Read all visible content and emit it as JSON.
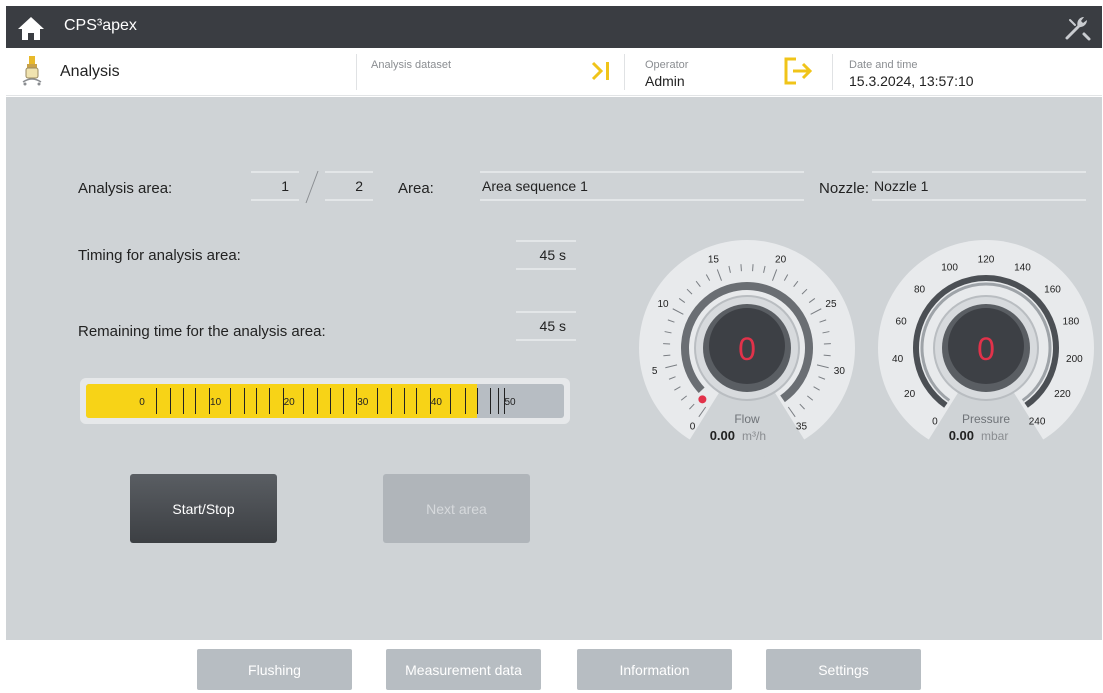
{
  "app": {
    "title": "CPS³apex"
  },
  "infobar": {
    "page_title": "Analysis",
    "dataset_label": "Analysis dataset",
    "operator_label": "Operator",
    "operator_value": "Admin",
    "datetime_label": "Date and time",
    "datetime_value": "15.3.2024, 13:57:10"
  },
  "analysis": {
    "area_label": "Analysis area:",
    "area_current": "1",
    "area_separator": "/",
    "area_total": "2",
    "area_name_label": "Area:",
    "area_name_value": "Area sequence 1",
    "nozzle_label": "Nozzle:",
    "nozzle_value": "Nozzle 1",
    "timing_label": "Timing for analysis area:",
    "timing_value": "45 s",
    "remaining_label": "Remaining time for the analysis area:",
    "remaining_value": "45 s"
  },
  "progress": {
    "fraction": 0.818,
    "tick_labels": [
      "0",
      "10",
      "20",
      "30",
      "40",
      "50"
    ]
  },
  "buttons": {
    "start_stop": "Start/Stop",
    "next_area": "Next area"
  },
  "flow_gauge": {
    "value_display": "0",
    "label": "Flow",
    "reading": "0.00",
    "unit": "m³/h",
    "scale_labels": [
      "0",
      "5",
      "10",
      "15",
      "20",
      "25",
      "30",
      "35"
    ],
    "min": 0,
    "max": 35,
    "value": 0
  },
  "pressure_gauge": {
    "value_display": "0",
    "label": "Pressure",
    "reading": "0.00",
    "unit": "mbar",
    "scale_labels": [
      "0",
      "20",
      "40",
      "60",
      "80",
      "100",
      "120",
      "140",
      "160",
      "180",
      "200",
      "220",
      "240"
    ],
    "min": 0,
    "max": 240,
    "value": 0
  },
  "nav": {
    "flushing": "Flushing",
    "measurement": "Measurement data",
    "information": "Information",
    "settings": "Settings"
  },
  "colors": {
    "accent_yellow": "#f7d317",
    "gauge_red": "#e2324a",
    "titlebar": "#3a3d42",
    "panel": "#cfd3d6"
  }
}
